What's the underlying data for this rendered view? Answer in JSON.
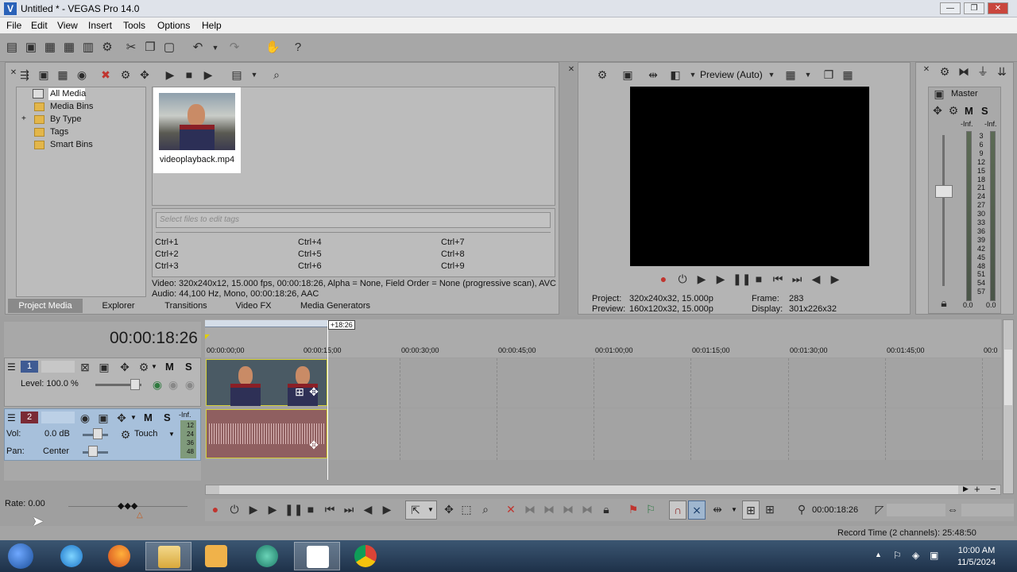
{
  "window": {
    "title": "Untitled * - VEGAS Pro 14.0",
    "logo_letter": "V",
    "minimize_symbol": "—",
    "maximize_symbol": "❐",
    "close_symbol": "✕"
  },
  "menu": [
    "File",
    "Edit",
    "View",
    "Insert",
    "Tools",
    "Options",
    "Help"
  ],
  "project_media": {
    "tree": [
      "All Media",
      "Media Bins",
      "By Type",
      "Tags",
      "Smart Bins"
    ],
    "tree_expander": "+",
    "thumbnail_name": "videoplayback.mp4",
    "tag_placeholder": "Select files to edit tags",
    "shortcuts": [
      "Ctrl+1",
      "Ctrl+4",
      "Ctrl+7",
      "Ctrl+2",
      "Ctrl+5",
      "Ctrl+8",
      "Ctrl+3",
      "Ctrl+6",
      "Ctrl+9"
    ],
    "info_video": "Video: 320x240x12, 15.000 fps, 00:00:18:26, Alpha = None, Field Order = None (progressive scan), AVC",
    "info_audio": "Audio: 44,100 Hz, Mono, 00:00:18:26, AAC"
  },
  "tabs": [
    "Project Media",
    "Explorer",
    "Transitions",
    "Video FX",
    "Media Generators"
  ],
  "preview": {
    "mode": "Preview (Auto)",
    "project_label": "Project:",
    "project_value": "320x240x32, 15.000p",
    "preview_label": "Preview:",
    "preview_value": "160x120x32, 15.000p",
    "frame_label": "Frame:",
    "frame_value": "283",
    "display_label": "Display:",
    "display_value": "301x226x32"
  },
  "master": {
    "label": "Master",
    "m": "M",
    "s": "S",
    "inf_left": "-Inf.",
    "inf_right": "-Inf.",
    "scale": [
      "3",
      "6",
      "9",
      "12",
      "15",
      "18",
      "21",
      "24",
      "27",
      "30",
      "33",
      "36",
      "39",
      "42",
      "45",
      "48",
      "51",
      "54",
      "57"
    ],
    "bottom_left": "0.0",
    "bottom_right": "0.0"
  },
  "timeline": {
    "timecode": "00:00:18:26",
    "length_badge": "+18:26",
    "ruler": [
      "00:00:00;00",
      "00:00:15;00",
      "00:00:30;00",
      "00:00:45;00",
      "00:01:00;00",
      "00:01:15;00",
      "00:01:30;00",
      "00:01:45;00",
      "00:0"
    ],
    "track1": {
      "number": "1",
      "level": "Level: 100.0 %",
      "m": "M",
      "s": "S"
    },
    "track2": {
      "number": "2",
      "vol_label": "Vol:",
      "vol_value": "0.0 dB",
      "pan_label": "Pan:",
      "pan_value": "Center",
      "automation": "Touch",
      "m": "M",
      "s": "S",
      "meter_top": "-Inf.",
      "meter_marks": [
        "12",
        "24",
        "36",
        "48"
      ]
    }
  },
  "transport": {
    "rate": "Rate: 0.00",
    "timecode": "00:00:18:26"
  },
  "status": {
    "record_time": "Record Time (2 channels): 25:48:50"
  },
  "taskbar": {
    "time": "10:00 AM",
    "date": "11/5/2024"
  }
}
